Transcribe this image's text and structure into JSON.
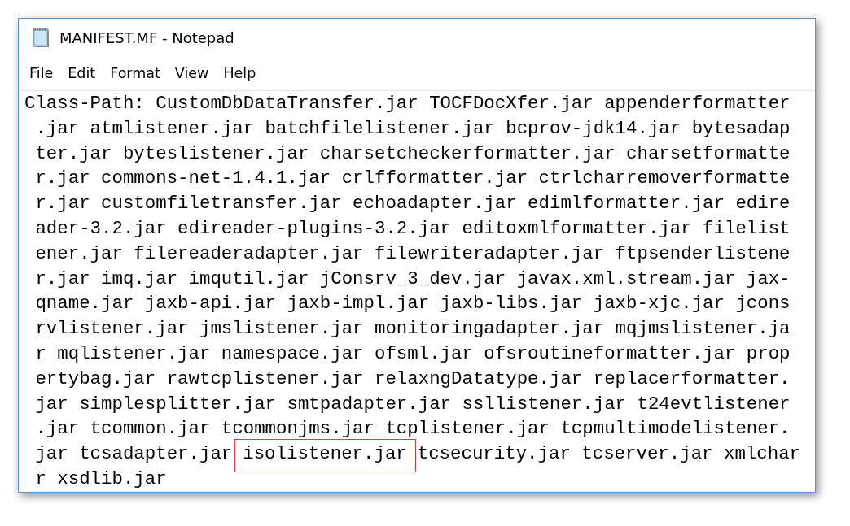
{
  "window": {
    "title": "MANIFEST.MF - Notepad"
  },
  "menu": [
    "File",
    "Edit",
    "Format",
    "View",
    "Help"
  ],
  "lines": [
    {
      "segments": [
        {
          "text": "Class-Path: CustomDbDataTransfer.jar TOCFDocXfer.jar appenderformatter",
          "highlighted": false
        }
      ]
    },
    {
      "segments": [
        {
          "text": " .jar atmlistener.jar batchfilelistener.jar bcprov-jdk14.jar bytesadap",
          "highlighted": false
        }
      ]
    },
    {
      "segments": [
        {
          "text": " ter.jar byteslistener.jar charsetcheckerformatter.jar charsetformatte",
          "highlighted": false
        }
      ]
    },
    {
      "segments": [
        {
          "text": " r.jar commons-net-1.4.1.jar crlfformatter.jar ctrlcharremoverformatte",
          "highlighted": false
        }
      ]
    },
    {
      "segments": [
        {
          "text": " r.jar customfiletransfer.jar echoadapter.jar edimlformatter.jar edire",
          "highlighted": false
        }
      ]
    },
    {
      "segments": [
        {
          "text": " ader-3.2.jar edireader-plugins-3.2.jar editoxmlformatter.jar filelist",
          "highlighted": false
        }
      ]
    },
    {
      "segments": [
        {
          "text": " ener.jar filereaderadapter.jar filewriteradapter.jar ftpsenderlistene",
          "highlighted": false
        }
      ]
    },
    {
      "segments": [
        {
          "text": " r.jar imq.jar imqutil.jar jConsrv_3_dev.jar javax.xml.stream.jar jax-",
          "highlighted": false
        }
      ]
    },
    {
      "segments": [
        {
          "text": " qname.jar jaxb-api.jar jaxb-impl.jar jaxb-libs.jar jaxb-xjc.jar jcons",
          "highlighted": false
        }
      ]
    },
    {
      "segments": [
        {
          "text": " rvlistener.jar jmslistener.jar monitoringadapter.jar mqjmslistener.ja",
          "highlighted": false
        }
      ]
    },
    {
      "segments": [
        {
          "text": " r mqlistener.jar namespace.jar ofsml.jar ofsroutineformatter.jar prop",
          "highlighted": false
        }
      ]
    },
    {
      "segments": [
        {
          "text": " ertybag.jar rawtcplistener.jar relaxngDatatype.jar replacerformatter.",
          "highlighted": false
        }
      ]
    },
    {
      "segments": [
        {
          "text": " jar simplesplitter.jar smtpadapter.jar ssllistener.jar t24evtlistener",
          "highlighted": false
        }
      ]
    },
    {
      "segments": [
        {
          "text": " .jar tcommon.jar tcommonjms.jar tcplistener.jar tcpmultimodelistener.",
          "highlighted": false
        }
      ]
    },
    {
      "segments": [
        {
          "text": " jar tcsadapter.jar ",
          "highlighted": false
        },
        {
          "text": "isolistener.jar",
          "highlighted": true
        },
        {
          "text": " tcsecurity.jar tcserver.jar xmlchar",
          "highlighted": false
        }
      ]
    },
    {
      "segments": [
        {
          "text": " r xsdlib.jar",
          "highlighted": false
        }
      ]
    }
  ]
}
